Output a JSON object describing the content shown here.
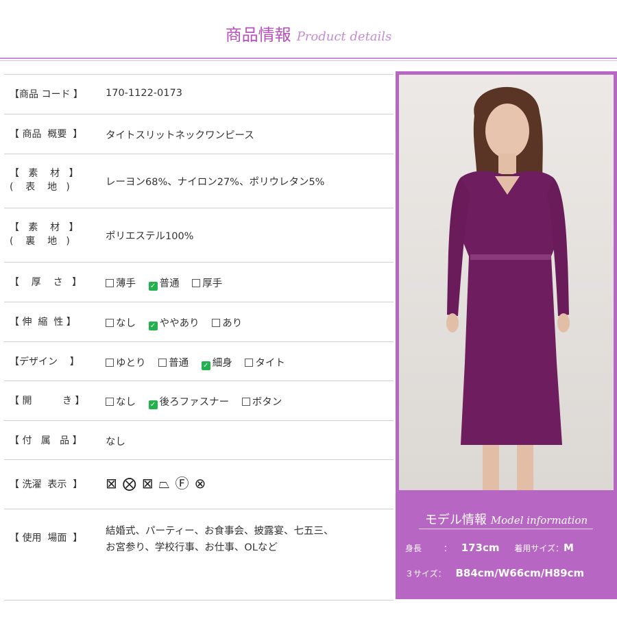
{
  "header": {
    "title_jp": "商品情報",
    "title_en": "Product details"
  },
  "rows": [
    {
      "label1": "【商品 コード 】",
      "value": "170-1122-0173"
    },
    {
      "label1": "【 商品  概要  】",
      "value": "タイトスリットネックワンピース"
    },
    {
      "label1": "【   素    材   】",
      "label2": "(    表    地   )",
      "value": "レーヨン68%、ナイロン27%、ポリウレタン5%"
    },
    {
      "label1": "【   素    材   】",
      "label2": "(    裏    地   )",
      "value": "ポリエステル100%"
    },
    {
      "label1": "【    厚    さ   】",
      "options": [
        {
          "text": "薄手",
          "checked": false
        },
        {
          "text": "普通",
          "checked": true
        },
        {
          "text": "厚手",
          "checked": false
        }
      ]
    },
    {
      "label1": "【 伸  縮  性 】",
      "options": [
        {
          "text": "なし",
          "checked": false
        },
        {
          "text": "ややあり",
          "checked": true
        },
        {
          "text": "あり",
          "checked": false
        }
      ]
    },
    {
      "label1": "【デザイン    】",
      "options": [
        {
          "text": "ゆとり",
          "checked": false
        },
        {
          "text": "普通",
          "checked": false
        },
        {
          "text": "細身",
          "checked": true
        },
        {
          "text": "タイト",
          "checked": false
        }
      ]
    },
    {
      "label1": "【 開          き 】",
      "options": [
        {
          "text": "なし",
          "checked": false
        },
        {
          "text": "後ろファスナー",
          "checked": true
        },
        {
          "text": "ボタン",
          "checked": false
        }
      ]
    },
    {
      "label1": "【 付   属   品 】",
      "value": "なし"
    },
    {
      "label1": "【 洗濯  表示  】",
      "care_icons": [
        "⊠",
        "⨂",
        "⊠",
        "⏢",
        "Ⓕ",
        "⊗"
      ]
    },
    {
      "label1": "【 使用  場面  】",
      "value_line1": "結婚式、パーティー、お食事会、披露宴、七五三、",
      "value_line2": "お宮参り、学校行事、お仕事、OLなど"
    }
  ],
  "model": {
    "title_jp": "モデル情報",
    "title_en": "Model information",
    "height_label": "身長",
    "height_sep": "：",
    "height_value": "173cm",
    "size_label": "着用サイズ：",
    "size_value": "M",
    "three_size_label": "３サイズ：",
    "three_size_value": "B84cm/W66cm/H89cm"
  },
  "colors": {
    "accent": "#b84fba",
    "panel": "#b866c3",
    "dress": "#6e1d5e",
    "check": "#22b14c"
  }
}
